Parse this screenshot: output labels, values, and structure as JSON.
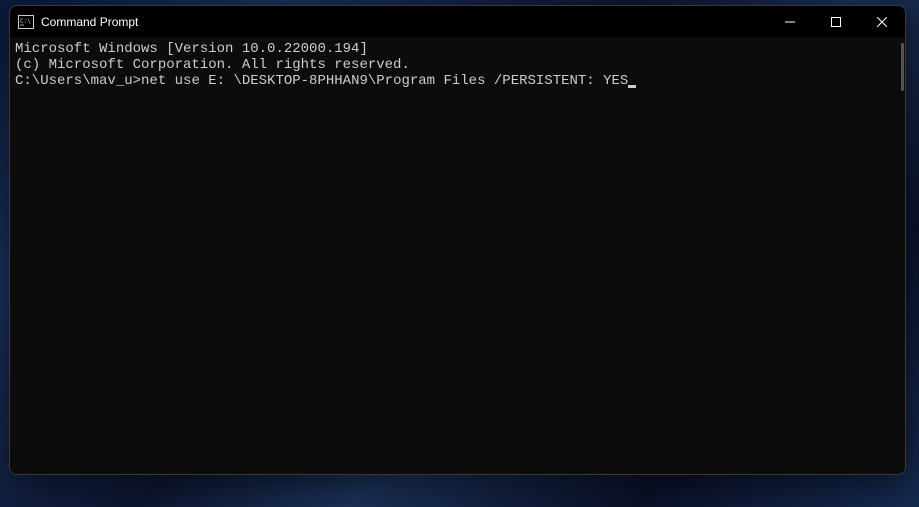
{
  "window": {
    "title": "Command Prompt"
  },
  "terminal": {
    "line1": "Microsoft Windows [Version 10.0.22000.194]",
    "line2": "(c) Microsoft Corporation. All rights reserved.",
    "blank": "",
    "prompt": "C:\\Users\\mav_u>",
    "command": "net use E: \\DESKTOP-8PHHAN9\\Program Files /PERSISTENT: YES"
  }
}
